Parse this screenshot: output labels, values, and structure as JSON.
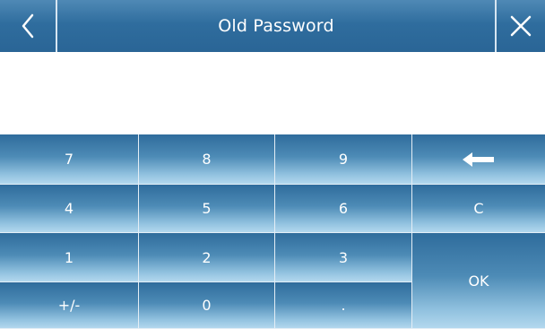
{
  "header": {
    "title": "Old Password",
    "back_icon": "chevron-left-icon",
    "close_icon": "close-icon"
  },
  "display": {
    "value": ""
  },
  "keypad": {
    "keys": {
      "k7": "7",
      "k8": "8",
      "k9": "9",
      "backspace_icon": "backspace-arrow-icon",
      "k4": "4",
      "k5": "5",
      "k6": "6",
      "clear": "C",
      "k1": "1",
      "k2": "2",
      "k3": "3",
      "ok": "OK",
      "plusminus": "+/-",
      "k0": "0",
      "decimal": "."
    }
  },
  "colors": {
    "header_top": "#4f89b5",
    "header_bottom": "#2a6596",
    "key_top": "#2f6c9c",
    "key_bottom": "#b3d8ee",
    "separator": "#d7e6f2"
  }
}
